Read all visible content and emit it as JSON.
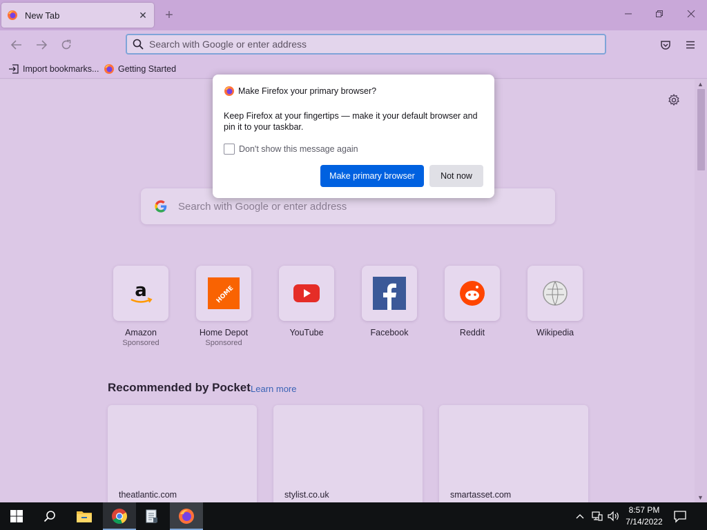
{
  "tab": {
    "title": "New Tab"
  },
  "navbar": {
    "url_placeholder": "Search with Google or enter address"
  },
  "bookmarks": [
    {
      "label": "Import bookmarks..."
    },
    {
      "label": "Getting Started"
    }
  ],
  "newtab_page": {
    "search_placeholder": "Search with Google or enter address",
    "top_sites": [
      {
        "name": "Amazon",
        "sponsored": "Sponsored",
        "icon": "amazon-logo"
      },
      {
        "name": "Home Depot",
        "sponsored": "Sponsored",
        "icon": "home-depot-logo"
      },
      {
        "name": "YouTube",
        "sponsored": "",
        "icon": "youtube-logo"
      },
      {
        "name": "Facebook",
        "sponsored": "",
        "icon": "facebook-logo"
      },
      {
        "name": "Reddit",
        "sponsored": "",
        "icon": "reddit-logo"
      },
      {
        "name": "Wikipedia",
        "sponsored": "",
        "icon": "wikipedia-logo"
      }
    ],
    "pocket": {
      "heading": "Recommended by Pocket",
      "learn_more": "Learn more",
      "cards": [
        {
          "source": "theatlantic.com"
        },
        {
          "source": "stylist.co.uk"
        },
        {
          "source": "smartasset.com"
        }
      ]
    }
  },
  "dialog": {
    "title": "Make Firefox your primary browser?",
    "body": "Keep Firefox at your fingertips — make it your default browser and pin it to your taskbar.",
    "checkbox_label": "Don't show this message again",
    "primary_button": "Make primary browser",
    "secondary_button": "Not now"
  },
  "taskbar": {
    "time": "8:57 PM",
    "date": "7/14/2022"
  },
  "colors": {
    "accent": "#0061e0",
    "theme_background": "#dcc8e6",
    "taskbar": "#101214"
  }
}
